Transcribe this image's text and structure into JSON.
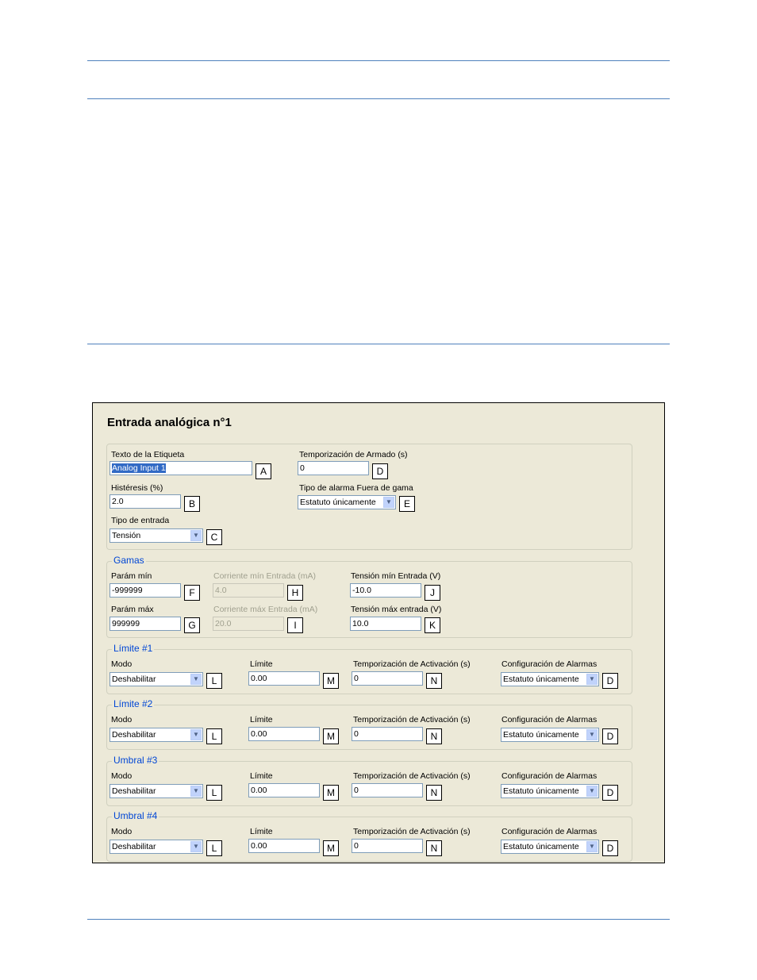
{
  "window": {
    "title": "Entrada analógica n°1"
  },
  "general": {
    "label_text": {
      "label": "Texto de la Etiqueta",
      "value": "Analog Input 1",
      "key": "A"
    },
    "hysteresis": {
      "label": "Histéresis (%)",
      "value": "2.0",
      "key": "B"
    },
    "input_type": {
      "label": "Tipo de entrada",
      "value": "Tensión",
      "key": "C"
    },
    "arming_delay": {
      "label": "Temporización de Armado (s)",
      "value": "0",
      "key": "D"
    },
    "out_of_range": {
      "label": "Tipo de alarma Fuera de gama",
      "value": "Estatuto únicamente",
      "key": "E"
    }
  },
  "ranges": {
    "title": "Gamas",
    "param_min": {
      "label": "Parám mín",
      "value": "-999999",
      "key": "F"
    },
    "param_max": {
      "label": "Parám máx",
      "value": "999999",
      "key": "G"
    },
    "current_min": {
      "label": "Corriente mín Entrada  (mA)",
      "value": "4.0",
      "key": "H"
    },
    "current_max": {
      "label": "Corriente máx Entrada  (mA)",
      "value": "20.0",
      "key": "I"
    },
    "voltage_min": {
      "label": "Tensión mín Entrada  (V)",
      "value": "-10.0",
      "key": "J"
    },
    "voltage_max": {
      "label": "Tensión máx entrada  (V)",
      "value": "10.0",
      "key": "K"
    }
  },
  "limits": [
    {
      "title": "Límite #1",
      "mode_label": "Modo",
      "mode": "Deshabilitar",
      "mode_key": "L",
      "limit_label": "Límite",
      "limit": "0.00",
      "limit_key": "M",
      "delay_label": "Temporización de Activación (s)",
      "delay": "0",
      "delay_key": "N",
      "alarm_label": "Configuración de Alarmas",
      "alarm": "Estatuto únicamente",
      "alarm_key": "D"
    },
    {
      "title": "Límite #2",
      "mode_label": "Modo",
      "mode": "Deshabilitar",
      "mode_key": "L",
      "limit_label": "Límite",
      "limit": "0.00",
      "limit_key": "M",
      "delay_label": "Temporización de Activación (s)",
      "delay": "0",
      "delay_key": "N",
      "alarm_label": "Configuración de Alarmas",
      "alarm": "Estatuto únicamente",
      "alarm_key": "D"
    },
    {
      "title": "Umbral #3",
      "mode_label": "Modo",
      "mode": "Deshabilitar",
      "mode_key": "L",
      "limit_label": "Límite",
      "limit": "0.00",
      "limit_key": "M",
      "delay_label": "Temporización de Activación (s)",
      "delay": "0",
      "delay_key": "N",
      "alarm_label": "Configuración de Alarmas",
      "alarm": "Estatuto únicamente",
      "alarm_key": "D"
    },
    {
      "title": "Umbral #4",
      "mode_label": "Modo",
      "mode": "Deshabilitar",
      "mode_key": "L",
      "limit_label": "Límite",
      "limit": "0.00",
      "limit_key": "M",
      "delay_label": "Temporización de Activación (s)",
      "delay": "0",
      "delay_key": "N",
      "alarm_label": "Configuración de Alarmas",
      "alarm": "Estatuto únicamente",
      "alarm_key": "D"
    }
  ]
}
